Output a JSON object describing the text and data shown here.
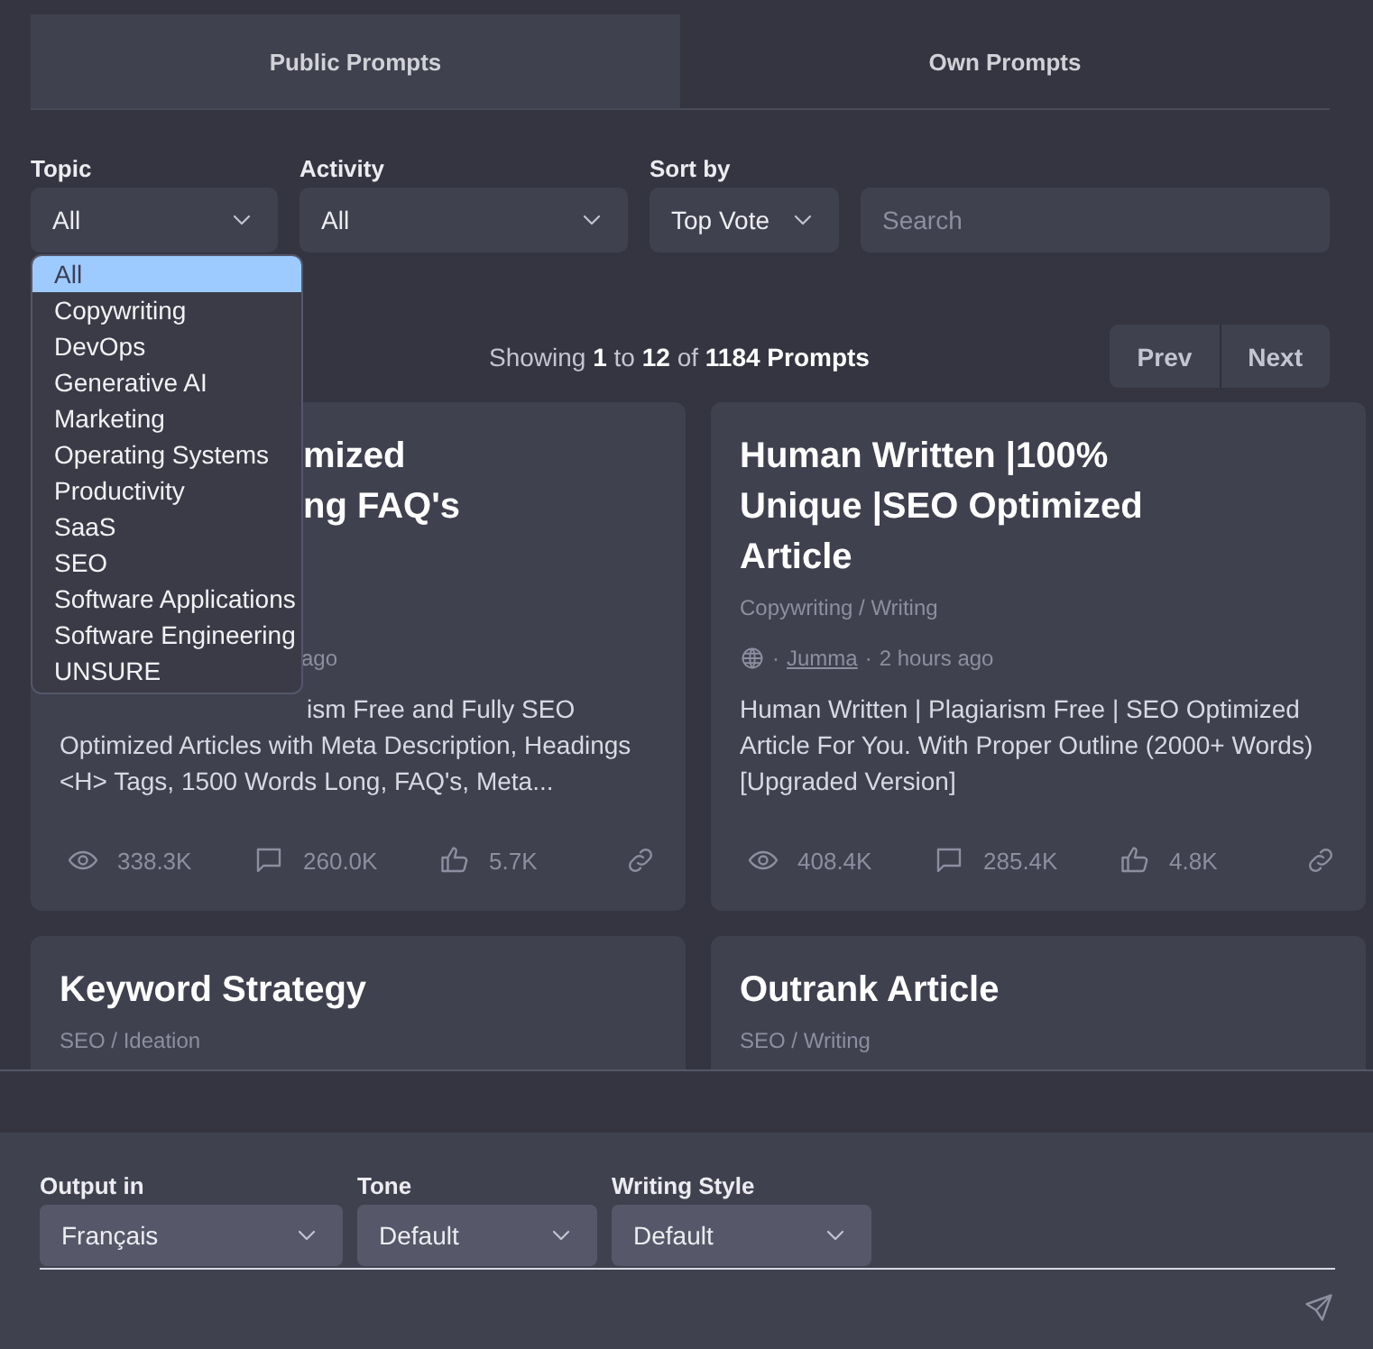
{
  "tabs": [
    {
      "label": "Public Prompts",
      "selected": true
    },
    {
      "label": "Own Prompts",
      "selected": false
    }
  ],
  "filters": [
    {
      "label": "Topic",
      "value": "All",
      "kind": "select"
    },
    {
      "label": "Activity",
      "value": "All",
      "kind": "select"
    },
    {
      "label": "Sort by",
      "value": "Top Vote",
      "kind": "select"
    },
    {
      "kind": "search",
      "placeholder": "Search"
    }
  ],
  "topic_menu": [
    {
      "label": "All",
      "selected": true
    },
    {
      "label": "Copywriting",
      "selected": false
    },
    {
      "label": "DevOps",
      "selected": false
    },
    {
      "label": "Generative AI",
      "selected": false
    },
    {
      "label": "Marketing",
      "selected": false
    },
    {
      "label": "Operating Systems",
      "selected": false
    },
    {
      "label": "Productivity",
      "selected": false
    },
    {
      "label": "SaaS",
      "selected": false
    },
    {
      "label": "SEO",
      "selected": false
    },
    {
      "label": "Software Applications",
      "selected": false
    },
    {
      "label": "Software Engineering",
      "selected": false
    },
    {
      "label": "UNSURE",
      "selected": false
    }
  ],
  "showing": "Showing **1** to **12** of **1184 Prompts**",
  "pagination": [
    "Prev",
    "Next"
  ],
  "cards": [
    {
      "covered": true,
      "title_lines": [
        "mized",
        "ng FAQ's"
      ],
      "meta_tail": "ago",
      "description_lines": [
        "ism Free and Fully SEO",
        "Optimized Articles with Meta Description, Headings",
        "<H> Tags, 1500 Words Long, FAQ's, Meta..."
      ],
      "views": "338.3K",
      "comments": "260.0K",
      "likes": "5.7K"
    },
    {
      "covered": false,
      "title_lines": [
        "Human Written |100%",
        "Unique |SEO Optimized",
        "Article"
      ],
      "category": "Copywriting / Writing",
      "author": "Jumma",
      "separator": "·",
      "time": "2 hours ago",
      "description_lines": [
        "Human Written | Plagiarism Free | SEO Optimized",
        "Article For You. With Proper Outline (2000+ Words)",
        "[Upgraded Version]"
      ],
      "views": "408.4K",
      "comments": "285.4K",
      "likes": "4.8K"
    },
    {
      "covered": false,
      "title_lines": [
        "Keyword Strategy"
      ],
      "category": "SEO / Ideation"
    },
    {
      "covered": false,
      "title_lines": [
        "Outrank Article"
      ],
      "category": "SEO / Writing"
    }
  ],
  "output_settings": [
    {
      "label": "Output in",
      "value": "Français"
    },
    {
      "label": "Tone",
      "value": "Default"
    },
    {
      "label": "Writing Style",
      "value": "Default"
    }
  ]
}
